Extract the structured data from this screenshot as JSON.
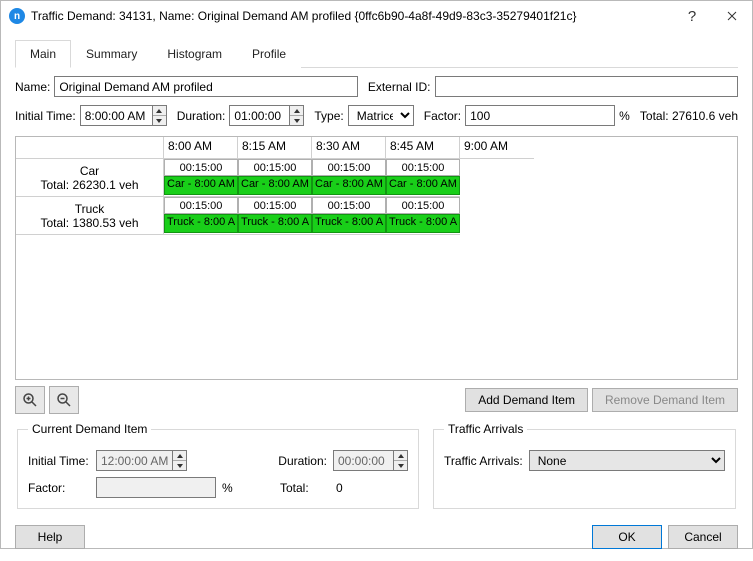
{
  "window": {
    "title": "Traffic Demand: 34131, Name: Original Demand AM profiled  {0ffc6b90-4a8f-49d9-83c3-35279401f21c}"
  },
  "tabs": {
    "main": "Main",
    "summary": "Summary",
    "histogram": "Histogram",
    "profile": "Profile"
  },
  "fields": {
    "name_label": "Name:",
    "name_value": "Original Demand AM profiled",
    "external_id_label": "External ID:",
    "external_id_value": "",
    "initial_time_label": "Initial Time:",
    "initial_time_value": "8:00:00 AM",
    "duration_label": "Duration:",
    "duration_value": "01:00:00",
    "type_label": "Type:",
    "type_value": "Matrices",
    "factor_label": "Factor:",
    "factor_value": "100",
    "factor_unit": "%",
    "total_label": "Total: 27610.6 veh"
  },
  "grid": {
    "time_headers": [
      "8:00 AM",
      "8:15 AM",
      "8:30 AM",
      "8:45 AM",
      "9:00 AM"
    ],
    "rows": [
      {
        "name": "Car",
        "total": "Total: 26230.1 veh",
        "slots": [
          {
            "dur": "00:15:00",
            "label": "Car - 8:00 AM"
          },
          {
            "dur": "00:15:00",
            "label": "Car - 8:00 AM"
          },
          {
            "dur": "00:15:00",
            "label": "Car - 8:00 AM"
          },
          {
            "dur": "00:15:00",
            "label": "Car - 8:00 AM"
          }
        ]
      },
      {
        "name": "Truck",
        "total": "Total: 1380.53 veh",
        "slots": [
          {
            "dur": "00:15:00",
            "label": "Truck - 8:00 A"
          },
          {
            "dur": "00:15:00",
            "label": "Truck - 8:00 A"
          },
          {
            "dur": "00:15:00",
            "label": "Truck - 8:00 A"
          },
          {
            "dur": "00:15:00",
            "label": "Truck - 8:00 A"
          }
        ]
      }
    ]
  },
  "buttons": {
    "add_item": "Add Demand Item",
    "remove_item": "Remove Demand Item",
    "help": "Help",
    "ok": "OK",
    "cancel": "Cancel"
  },
  "current_item": {
    "legend": "Current Demand Item",
    "initial_time_label": "Initial Time:",
    "initial_time_value": "12:00:00 AM",
    "duration_label": "Duration:",
    "duration_value": "00:00:00",
    "factor_label": "Factor:",
    "factor_value": "",
    "factor_unit": "%",
    "total_label": "Total:",
    "total_value": "0"
  },
  "arrivals": {
    "legend": "Traffic Arrivals",
    "label": "Traffic Arrivals:",
    "value": "None"
  }
}
